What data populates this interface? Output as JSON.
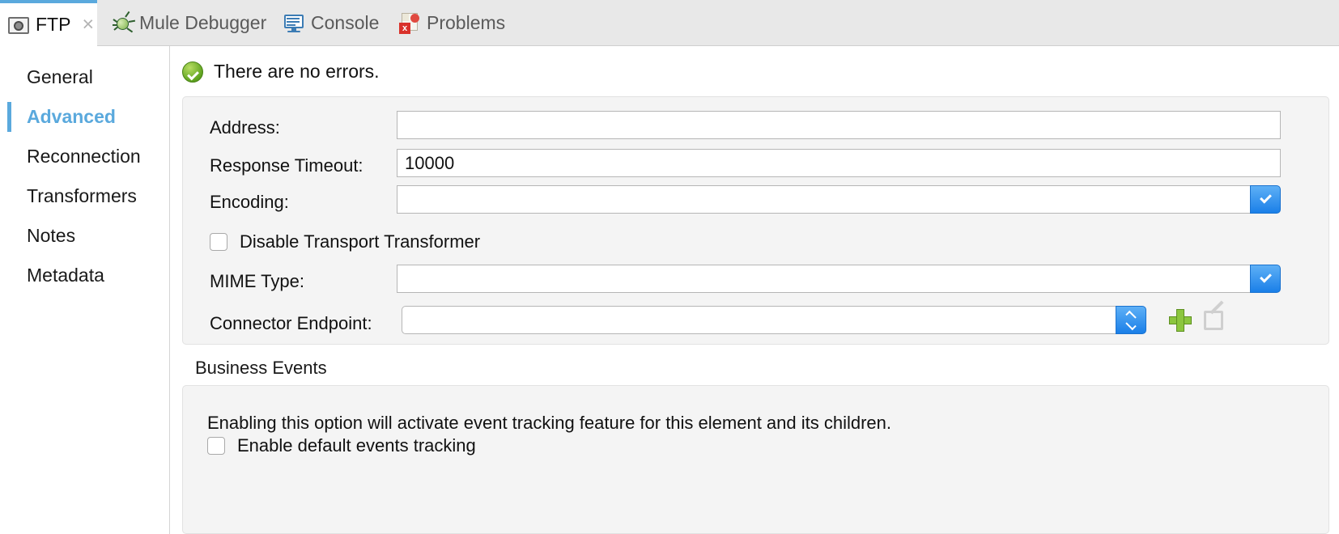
{
  "tabs": [
    {
      "label": "FTP",
      "icon": "ftp-folder-icon",
      "active": true,
      "closable": true
    },
    {
      "label": "Mule Debugger",
      "icon": "bug-icon",
      "active": false,
      "closable": false
    },
    {
      "label": "Console",
      "icon": "console-monitor-icon",
      "active": false,
      "closable": false
    },
    {
      "label": "Problems",
      "icon": "problems-error-icon",
      "active": false,
      "closable": false
    }
  ],
  "tab_close_glyph": "×",
  "sidebar": {
    "items": [
      {
        "label": "General",
        "active": false
      },
      {
        "label": "Advanced",
        "active": true
      },
      {
        "label": "Reconnection",
        "active": false
      },
      {
        "label": "Transformers",
        "active": false
      },
      {
        "label": "Notes",
        "active": false
      },
      {
        "label": "Metadata",
        "active": false
      }
    ]
  },
  "status": {
    "icon": "success-check-icon",
    "text": "There are no errors."
  },
  "form": {
    "address": {
      "label": "Address:",
      "value": ""
    },
    "response_timeout": {
      "label": "Response Timeout:",
      "value": "10000"
    },
    "encoding": {
      "label": "Encoding:",
      "value": ""
    },
    "disable_transport_transformer": {
      "label": "Disable Transport Transformer",
      "checked": false
    },
    "mime_type": {
      "label": "MIME Type:",
      "value": ""
    },
    "connector_endpoint": {
      "label": "Connector Endpoint:",
      "value": ""
    },
    "add_button_name": "add-connector-endpoint",
    "edit_button_name": "edit-connector-endpoint"
  },
  "business_events": {
    "title": "Business Events",
    "description": "Enabling this option will activate event tracking feature for this element and its children.",
    "enable_default_events_tracking": {
      "label": "Enable default events tracking",
      "checked": false
    }
  },
  "colors": {
    "accent": "#5aa9dd",
    "dropdown_blue": "#1a7fe8",
    "success_green": "#5fa320",
    "plus_green": "#8cc63f",
    "panel_bg": "#f4f4f4",
    "tabbar_bg": "#e8e8e8"
  }
}
